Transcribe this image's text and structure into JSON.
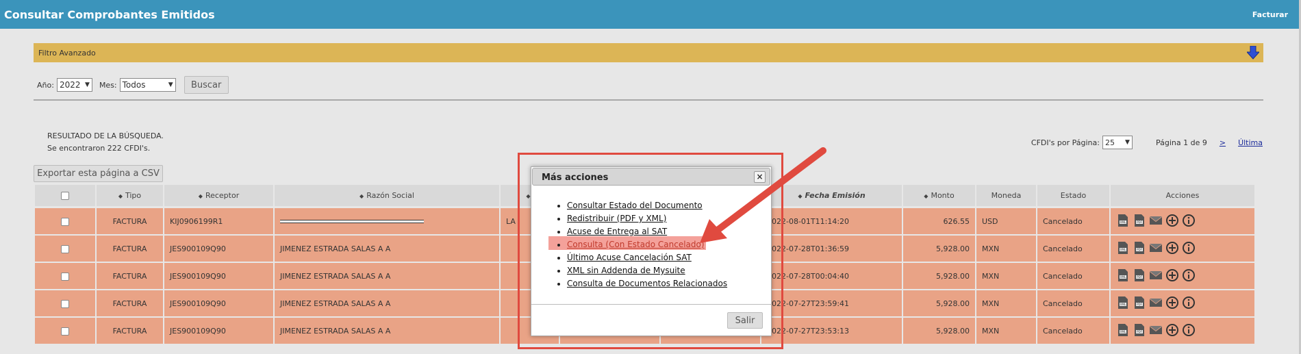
{
  "header": {
    "title": "Consultar Comprobantes Emitidos",
    "right_link": "Facturar",
    "bar_color": "#3b94bb"
  },
  "filter": {
    "bar_label": "Filtro Avanzado",
    "bar_color": "#dcb556",
    "year_label": "Año:",
    "year_value": "2022",
    "month_label": "Mes:",
    "month_value": "Todos",
    "search_button": "Buscar"
  },
  "result": {
    "line1": "RESULTADO DE LA BÚSQUEDA.",
    "line2": "Se encontraron 222 CFDI's.",
    "per_page_label": "CFDI's por Página:",
    "per_page_value": "25",
    "page_info": "Página 1 de 9",
    "next": ">",
    "last": "Última",
    "export_button": "Exportar esta página a CSV"
  },
  "table": {
    "columns": [
      "Tipo",
      "Receptor",
      "Razón Social",
      "",
      "",
      "",
      "Fecha Emisión",
      "Monto",
      "Moneda",
      "Estado",
      "Acciones"
    ],
    "row_color": "#e9a386",
    "rows": [
      {
        "tipo": "FACTURA",
        "receptor": "KIJ0906199R1",
        "razon": "",
        "extra": "LA",
        "fecha": "2022-08-01T11:14:20",
        "monto": "626.55",
        "moneda": "USD",
        "estado": "Cancelado"
      },
      {
        "tipo": "FACTURA",
        "receptor": "JES900109Q90",
        "razon": "JIMENEZ ESTRADA SALAS A A",
        "extra": "",
        "fecha": "2022-07-28T01:36:59",
        "monto": "5,928.00",
        "moneda": "MXN",
        "estado": "Cancelado"
      },
      {
        "tipo": "FACTURA",
        "receptor": "JES900109Q90",
        "razon": "JIMENEZ ESTRADA SALAS A A",
        "extra": "",
        "fecha": "2022-07-28T00:04:40",
        "monto": "5,928.00",
        "moneda": "MXN",
        "estado": "Cancelado"
      },
      {
        "tipo": "FACTURA",
        "receptor": "JES900109Q90",
        "razon": "JIMENEZ ESTRADA SALAS A A",
        "extra": "",
        "fecha": "2022-07-27T23:59:41",
        "monto": "5,928.00",
        "moneda": "MXN",
        "estado": "Cancelado"
      },
      {
        "tipo": "FACTURA",
        "receptor": "JES900109Q90",
        "razon": "JIMENEZ ESTRADA SALAS A A",
        "extra": "",
        "fecha": "2022-07-27T23:53:13",
        "monto": "5,928.00",
        "moneda": "MXN",
        "estado": "Cancelado"
      }
    ],
    "action_icons": [
      "xml-file-icon",
      "pdf-file-icon",
      "envelope-icon",
      "plus-circle-icon",
      "info-circle-icon"
    ]
  },
  "dialog": {
    "title": "Más acciones",
    "close": "×",
    "items": [
      "Consultar Estado del Documento",
      "Redistribuir (PDF y XML)",
      "Acuse de Entrega al SAT",
      "Consulta (Con Estado Cancelado)",
      "Último Acuse Cancelación SAT",
      "XML sin Addenda de Mysuite",
      "Consulta de Documentos Relacionados"
    ],
    "highlighted_index": 3,
    "exit_button": "Salir",
    "annotation_color": "#e04a3f"
  }
}
